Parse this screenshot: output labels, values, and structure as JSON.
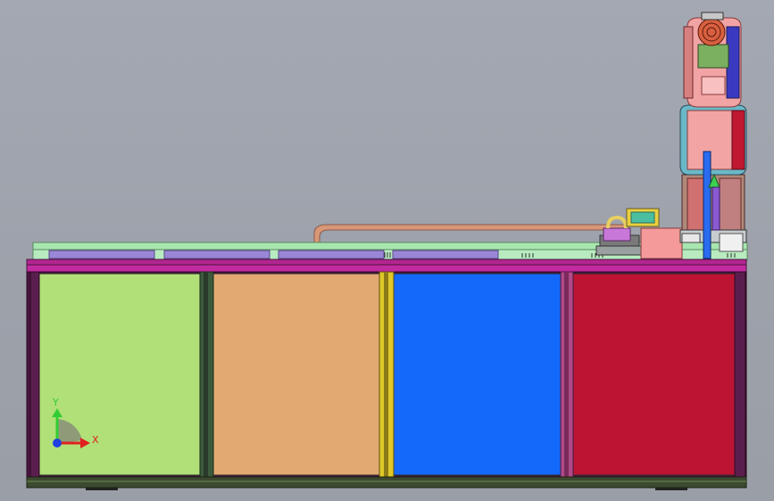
{
  "viewport": {
    "background": "#9ea2ab"
  },
  "cabinet": {
    "panels": [
      {
        "name": "green-panel",
        "color": "#b0e077"
      },
      {
        "name": "orange-panel",
        "color": "#e2aa72"
      },
      {
        "name": "blue-panel",
        "color": "#1469fb"
      },
      {
        "name": "red-panel",
        "color": "#bd1434"
      }
    ],
    "frame_color": "#4a1640",
    "top_rail_color": "#c22aa0",
    "base_color": "#3c4a30"
  },
  "conveyor": {
    "rail_color": "#a8e6b0",
    "track_color": "#9a86d6",
    "cable_color": "#d89878"
  },
  "robot": {
    "body_color": "#f0a0a0",
    "accent_color": "#5ab8c8",
    "shaft_color": "#2a6cf0"
  },
  "triad": {
    "y_label": "Y",
    "x_label": "X",
    "y_color": "#33cc33",
    "x_color": "#e02020",
    "origin_color": "#2040e0"
  }
}
